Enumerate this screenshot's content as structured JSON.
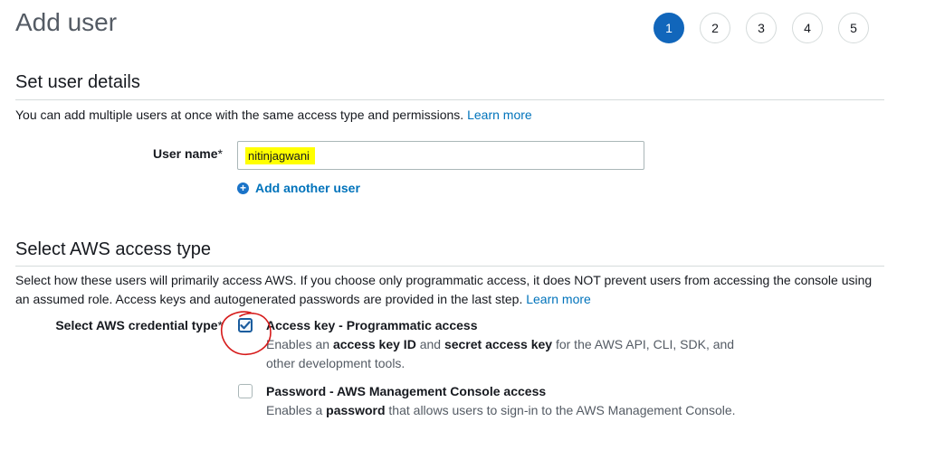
{
  "page": {
    "title": "Add user"
  },
  "steps": [
    "1",
    "2",
    "3",
    "4",
    "5"
  ],
  "user_details": {
    "title": "Set user details",
    "description": "You can add multiple users at once with the same access type and permissions.",
    "learn_more": "Learn more",
    "user_name_label": "User name",
    "required_mark": "*",
    "user_name_value": "nitinjagwani",
    "add_another_label": "Add another user",
    "add_icon_glyph": "+"
  },
  "access_type": {
    "title": "Select AWS access type",
    "description": "Select how these users will primarily access AWS. If you choose only programmatic access, it does NOT prevent users from accessing the console using an assumed role. Access keys and autogenerated passwords are provided in the last step.",
    "learn_more": "Learn more",
    "credential_label": "Select AWS credential type",
    "required_mark": "*",
    "options": [
      {
        "title": "Access key - Programmatic access",
        "checked": true,
        "desc_1": "Enables an ",
        "desc_b1": "access key ID",
        "desc_2": " and ",
        "desc_b2": "secret access key",
        "desc_3": " for the AWS API, CLI, SDK, and other development tools."
      },
      {
        "title": "Password - AWS Management Console access",
        "checked": false,
        "desc_1": "Enables a ",
        "desc_b1": "password",
        "desc_2": " that allows users to sign-in to the AWS Management Console."
      }
    ]
  },
  "colors": {
    "accent": "#1166bb",
    "link": "#0073bb",
    "highlight": "#ffff00",
    "annotation": "#d61a1a"
  }
}
